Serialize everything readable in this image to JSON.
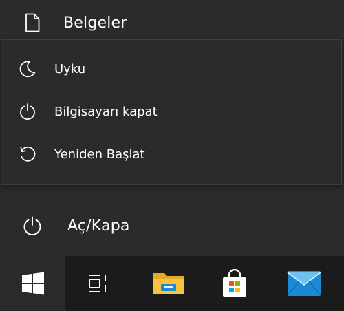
{
  "start_menu": {
    "documents_label": "Belgeler",
    "power_label": "Aç/Kapa"
  },
  "power_flyout": {
    "items": [
      {
        "label": "Uyku",
        "icon": "sleep-moon-icon"
      },
      {
        "label": "Bilgisayarı kapat",
        "icon": "power-icon"
      },
      {
        "label": "Yeniden Başlat",
        "icon": "restart-icon"
      }
    ]
  },
  "taskbar": {
    "items": [
      {
        "icon": "windows-start-icon"
      },
      {
        "icon": "task-view-icon"
      },
      {
        "icon": "file-explorer-icon"
      },
      {
        "icon": "microsoft-store-icon"
      },
      {
        "icon": "mail-icon"
      }
    ]
  },
  "colors": {
    "panel_bg": "#2b2b2b",
    "taskbar_bg": "#1b1b1b",
    "text": "#ffffff",
    "folder_yellow": "#f6c343",
    "mail_blue": "#1a8ad4"
  }
}
